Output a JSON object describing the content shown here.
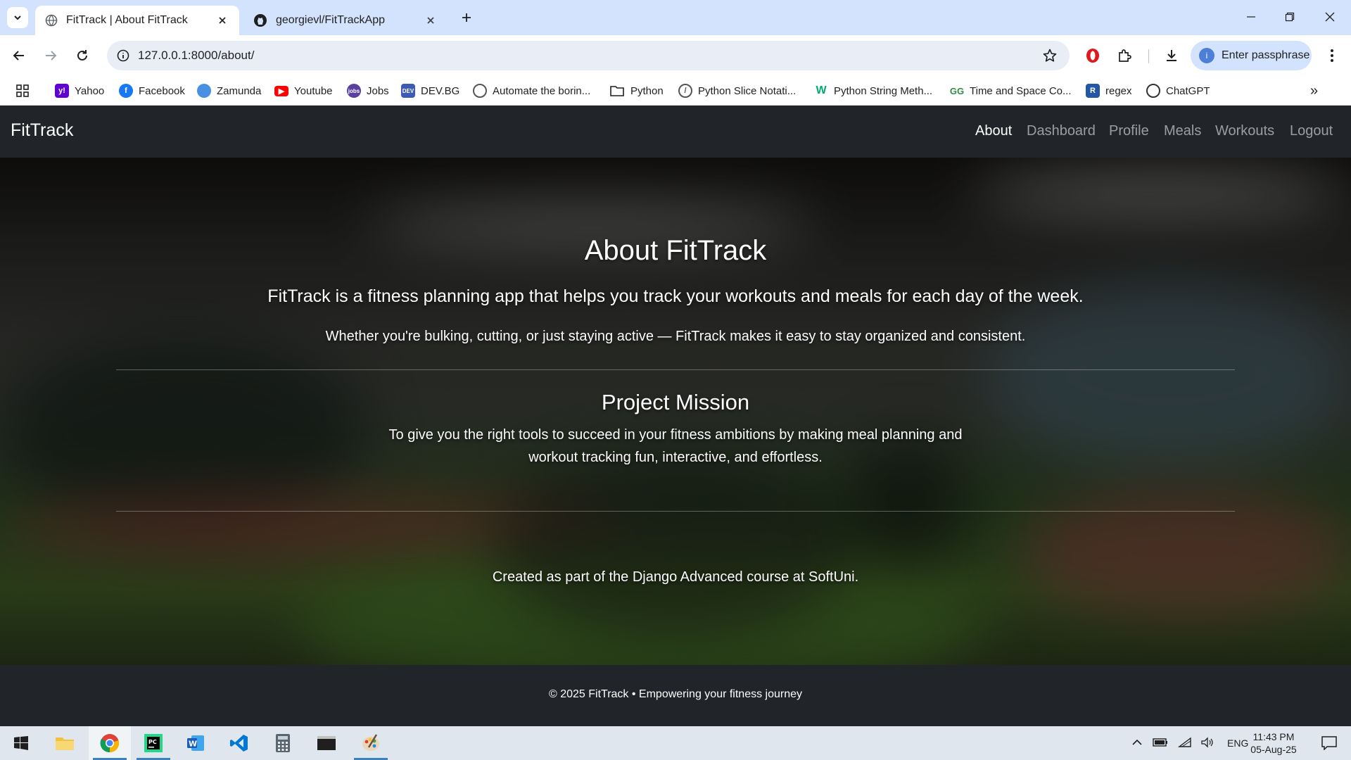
{
  "browser": {
    "tabs": [
      {
        "title": "FitTrack | About FitTrack",
        "active": true,
        "icon": "globe-icon"
      },
      {
        "title": "georgievl/FitTrackApp",
        "active": false,
        "icon": "github-icon"
      }
    ],
    "url": "127.0.0.1:8000/about/",
    "profile_label": "Enter passphrase",
    "bookmarks": [
      {
        "label": "Yahoo",
        "icon": "yahoo-icon",
        "color": "#6001d2"
      },
      {
        "label": "Facebook",
        "icon": "facebook-icon",
        "color": "#1877f2"
      },
      {
        "label": "Zamunda",
        "icon": "zamunda-icon",
        "color": "#4a90e2"
      },
      {
        "label": "Youtube",
        "icon": "youtube-icon",
        "color": "#ff0000"
      },
      {
        "label": "Jobs",
        "icon": "jobs-icon",
        "color": "#5b3f9e"
      },
      {
        "label": "DEV.BG",
        "icon": "devbg-icon",
        "color": "#3d5ab5"
      },
      {
        "label": "Automate the borin...",
        "icon": "automate-icon",
        "color": "#555555"
      },
      {
        "label": "Python",
        "icon": "folder-icon",
        "color": "#555555"
      },
      {
        "label": "Python Slice Notati...",
        "icon": "python-slice-icon",
        "color": "#555555"
      },
      {
        "label": "Python String Meth...",
        "icon": "w3schools-icon",
        "color": "#04aa6d"
      },
      {
        "label": "Time and Space Co...",
        "icon": "geeksforgeeks-icon",
        "color": "#2f8d46"
      },
      {
        "label": "regex",
        "icon": "regex-icon",
        "color": "#2456a6"
      },
      {
        "label": "ChatGPT",
        "icon": "chatgpt-icon",
        "color": "#333333"
      }
    ]
  },
  "site": {
    "brand": "FitTrack",
    "nav": [
      "About",
      "Dashboard",
      "Profile",
      "Meals",
      "Workouts",
      "Logout"
    ],
    "active_nav": "About"
  },
  "hero": {
    "title": "About FitTrack",
    "lead": "FitTrack is a fitness planning app that helps you track your workouts and meals for each day of the week.",
    "sub": "Whether you're bulking, cutting, or just staying active — FitTrack makes it easy to stay organized and consistent.",
    "mission_title": "Project Mission",
    "mission_text": "To give you the right tools to succeed in your fitness ambitions by making meal planning and workout tracking fun, interactive, and effortless.",
    "credit": "Created as part of the Django Advanced course at SoftUni."
  },
  "footer": {
    "text": "© 2025 FitTrack • Empowering your fitness journey"
  },
  "taskbar": {
    "apps": [
      "start-icon",
      "file-explorer-icon",
      "chrome-icon",
      "pycharm-icon",
      "word-icon",
      "vscode-icon",
      "calculator-icon",
      "terminal-icon",
      "paint-icon"
    ],
    "language": "ENG",
    "time": "11:43 PM",
    "date": "05-Aug-25"
  },
  "colors": {
    "tabstrip": "#d3e3fd",
    "navbar": "#212529",
    "accent": "#1a73e8"
  }
}
